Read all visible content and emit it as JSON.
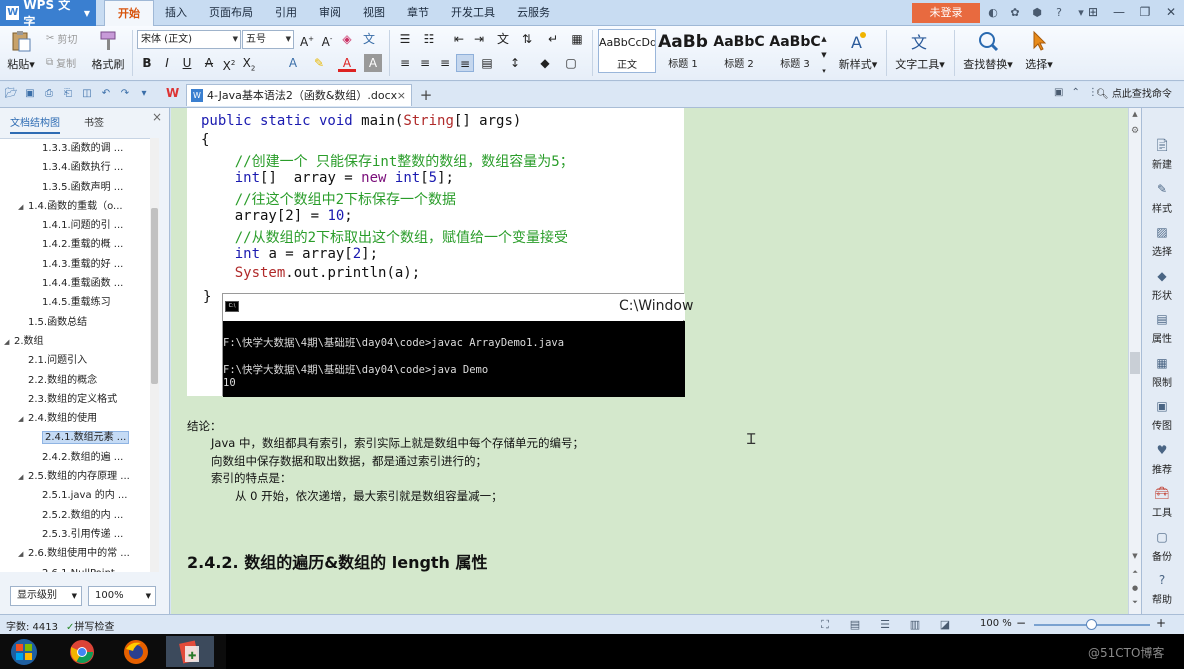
{
  "app": {
    "name": "WPS 文字",
    "login_label": "未登录"
  },
  "menu": {
    "tabs": [
      "开始",
      "插入",
      "页面布局",
      "引用",
      "审阅",
      "视图",
      "章节",
      "开发工具",
      "云服务"
    ],
    "active_tab": "开始"
  },
  "ribbon": {
    "paste": "粘贴",
    "cut": "剪切",
    "copy": "复制",
    "format_painter": "格式刷",
    "font_name": "宋体 (正文)",
    "font_size": "五号",
    "styles": [
      {
        "sample": "AaBbCcDd",
        "label": "正文"
      },
      {
        "sample": "AaBb",
        "label": "标题 1"
      },
      {
        "sample": "AaBbC",
        "label": "标题 2"
      },
      {
        "sample": "AaBbC",
        "label": "标题 3"
      }
    ],
    "new_style": "新样式",
    "text_tools": "文字工具",
    "find_replace": "查找替换",
    "select": "选择"
  },
  "document_tab": {
    "title": "4-Java基本语法2（函数&数组）.docx",
    "close": "×",
    "new_tab": "+",
    "command_search": "点此查找命令"
  },
  "nav": {
    "tab_outline": "文档结构图",
    "tab_bookmarks": "书签",
    "close": "×",
    "items": [
      {
        "text": "1.3.3.函数的调 ...",
        "indent": 3,
        "toggle": ""
      },
      {
        "text": "1.3.4.函数执行 ...",
        "indent": 3,
        "toggle": ""
      },
      {
        "text": "1.3.5.函数声明 ...",
        "indent": 3,
        "toggle": ""
      },
      {
        "text": "1.4.函数的重载（o...",
        "indent": 2,
        "toggle": "◢"
      },
      {
        "text": "1.4.1.问题的引 ...",
        "indent": 3,
        "toggle": ""
      },
      {
        "text": "1.4.2.重载的概 ...",
        "indent": 3,
        "toggle": ""
      },
      {
        "text": "1.4.3.重载的好 ...",
        "indent": 3,
        "toggle": ""
      },
      {
        "text": "1.4.4.重载函数 ...",
        "indent": 3,
        "toggle": ""
      },
      {
        "text": "1.4.5.重载练习",
        "indent": 3,
        "toggle": ""
      },
      {
        "text": "1.5.函数总结",
        "indent": 2,
        "toggle": ""
      },
      {
        "text": "2.数组",
        "indent": 1,
        "toggle": "◢"
      },
      {
        "text": "2.1.问题引入",
        "indent": 2,
        "toggle": ""
      },
      {
        "text": "2.2.数组的概念",
        "indent": 2,
        "toggle": ""
      },
      {
        "text": "2.3.数组的定义格式",
        "indent": 2,
        "toggle": ""
      },
      {
        "text": "2.4.数组的使用",
        "indent": 2,
        "toggle": "◢"
      },
      {
        "text": "2.4.1.数组元素 ...",
        "indent": 3,
        "toggle": "",
        "selected": true
      },
      {
        "text": "2.4.2.数组的遍 ...",
        "indent": 3,
        "toggle": ""
      },
      {
        "text": "2.5.数组的内存原理 ...",
        "indent": 2,
        "toggle": "◢"
      },
      {
        "text": "2.5.1.java 的内 ...",
        "indent": 3,
        "toggle": ""
      },
      {
        "text": "2.5.2.数组的内 ...",
        "indent": 3,
        "toggle": ""
      },
      {
        "text": "2.5.3.引用传递 ...",
        "indent": 3,
        "toggle": ""
      },
      {
        "text": "2.6.数组使用中的常 ...",
        "indent": 2,
        "toggle": "◢"
      },
      {
        "text": "2.6.1.NullPoint...",
        "indent": 3,
        "toggle": ""
      }
    ],
    "level_select": "显示级别",
    "zoom_select": "100%"
  },
  "code": {
    "lines": [
      [
        {
          "t": "public static void ",
          "c": "kw2"
        },
        {
          "t": "main(",
          "c": ""
        },
        {
          "t": "String",
          "c": "cls"
        },
        {
          "t": "[] args)",
          "c": ""
        }
      ],
      [
        {
          "t": "{",
          "c": ""
        }
      ],
      [
        {
          "t": "    //创建一个 只能保存int整数的数组，数组容量为5；",
          "c": "cm"
        }
      ],
      [
        {
          "t": "    ",
          "c": ""
        },
        {
          "t": "int",
          "c": "kw2"
        },
        {
          "t": "[]  array = ",
          "c": ""
        },
        {
          "t": "new",
          "c": "kw"
        },
        {
          "t": " ",
          "c": ""
        },
        {
          "t": "int",
          "c": "kw2"
        },
        {
          "t": "[",
          "c": ""
        },
        {
          "t": "5",
          "c": "num"
        },
        {
          "t": "];",
          "c": ""
        }
      ],
      [
        {
          "t": "    //往这个数组中2下标保存一个数据",
          "c": "cm"
        }
      ],
      [
        {
          "t": "    array[2] = ",
          "c": ""
        },
        {
          "t": "10",
          "c": "num"
        },
        {
          "t": ";",
          "c": ""
        }
      ],
      [
        {
          "t": "    //从数组的2下标取出这个数组，赋值给一个变量接受",
          "c": "cm"
        }
      ],
      [
        {
          "t": "    ",
          "c": ""
        },
        {
          "t": "int",
          "c": "kw2"
        },
        {
          "t": " a = array[",
          "c": ""
        },
        {
          "t": "2",
          "c": "num"
        },
        {
          "t": "];",
          "c": ""
        }
      ],
      [
        {
          "t": "    ",
          "c": ""
        },
        {
          "t": "System",
          "c": "cls"
        },
        {
          "t": ".out.println(a);",
          "c": ""
        }
      ]
    ],
    "closing": "}"
  },
  "cmd": {
    "title": "C:\\Window",
    "lines": [
      "F:\\快学大数据\\4期\\基础班\\day04\\code>javac ArrayDemo1.java",
      "F:\\快学大数据\\4期\\基础班\\day04\\code>java Demo",
      "10"
    ]
  },
  "conclusion": {
    "title": "结论：",
    "line1": "Java 中，数组都具有索引，索引实际上就是数组中每个存储单元的编号；",
    "line2": "向数组中保存数据和取出数据，都是通过索引进行的；",
    "line3": "索引的特点是：",
    "line4": "从 0 开始，依次递增，最大索引就是数组容量减一；"
  },
  "heading": "2.4.2. 数组的遍历&数组的 length 属性",
  "task_pane": [
    "新建",
    "样式",
    "选择",
    "形状",
    "属性",
    "限制",
    "传图",
    "推荐",
    "工具",
    "备份",
    "帮助"
  ],
  "status": {
    "word_count": "字数: 4413",
    "spell_check": "拼写检查",
    "zoom": "100 %"
  },
  "watermark": "@51CTO博客",
  "colors": {
    "accent": "#3a7fd0",
    "login": "#e86a3f",
    "active_menu": "#d7540d",
    "canvas_bg": "#d4e8cc",
    "comment_green": "#2a9d2a"
  }
}
